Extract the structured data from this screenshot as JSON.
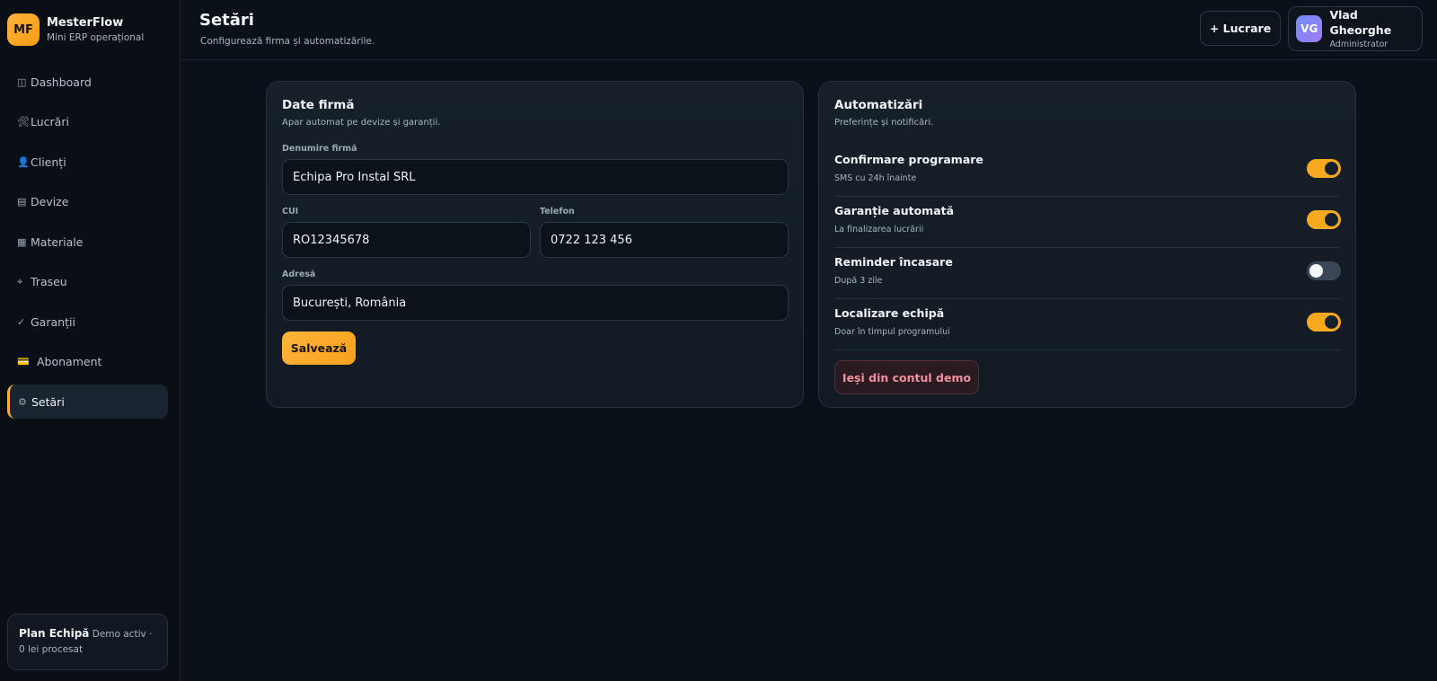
{
  "brand": {
    "logo": "MF",
    "name": "MesterFlow",
    "subtitle": "Mini ERP operațional"
  },
  "sidebar": {
    "items": [
      {
        "icon": "◫",
        "label": "Dashboard"
      },
      {
        "icon": "🛠",
        "label": "Lucrări"
      },
      {
        "icon": "👤",
        "label": "Clienți"
      },
      {
        "icon": "▤",
        "label": "Devize"
      },
      {
        "icon": "▦",
        "label": "Materiale"
      },
      {
        "icon": "⌖",
        "label": "Traseu"
      },
      {
        "icon": "✓",
        "label": "Garanții"
      },
      {
        "icon": "💳",
        "label": "Abonament"
      },
      {
        "icon": "⚙",
        "label": "Setări",
        "active": true
      }
    ],
    "plan": {
      "name": "Plan Echipă",
      "status": "Demo activ · 0 lei procesat"
    }
  },
  "header": {
    "title": "Setări",
    "subtitle": "Configurează firma și automatizările.",
    "new_button": "+ Lucrare",
    "user": {
      "initials": "VG",
      "name": "Vlad Gheorghe",
      "role": "Administrator"
    }
  },
  "company": {
    "title": "Date firmă",
    "subtitle": "Apar automat pe devize și garanții.",
    "fields": {
      "name": {
        "label": "Denumire firmă",
        "value": "Echipa Pro Instal SRL"
      },
      "cui": {
        "label": "CUI",
        "value": "RO12345678"
      },
      "phone": {
        "label": "Telefon",
        "value": "0722 123 456"
      },
      "address": {
        "label": "Adresă",
        "value": "București, România"
      }
    },
    "save_label": "Salvează"
  },
  "automations": {
    "title": "Automatizări",
    "subtitle": "Preferințe și notificări.",
    "items": [
      {
        "title": "Confirmare programare",
        "subtitle": "SMS cu 24h înainte",
        "enabled": true
      },
      {
        "title": "Garanție automată",
        "subtitle": "La finalizarea lucrării",
        "enabled": true
      },
      {
        "title": "Reminder încasare",
        "subtitle": "După 3 zile",
        "enabled": false
      },
      {
        "title": "Localizare echipă",
        "subtitle": "Doar în timpul programului",
        "enabled": true
      }
    ],
    "exit_demo_label": "Ieși din contul demo"
  },
  "colors": {
    "accent": "#f4a91f",
    "danger": "#f2909e",
    "background": "#0b1119"
  }
}
